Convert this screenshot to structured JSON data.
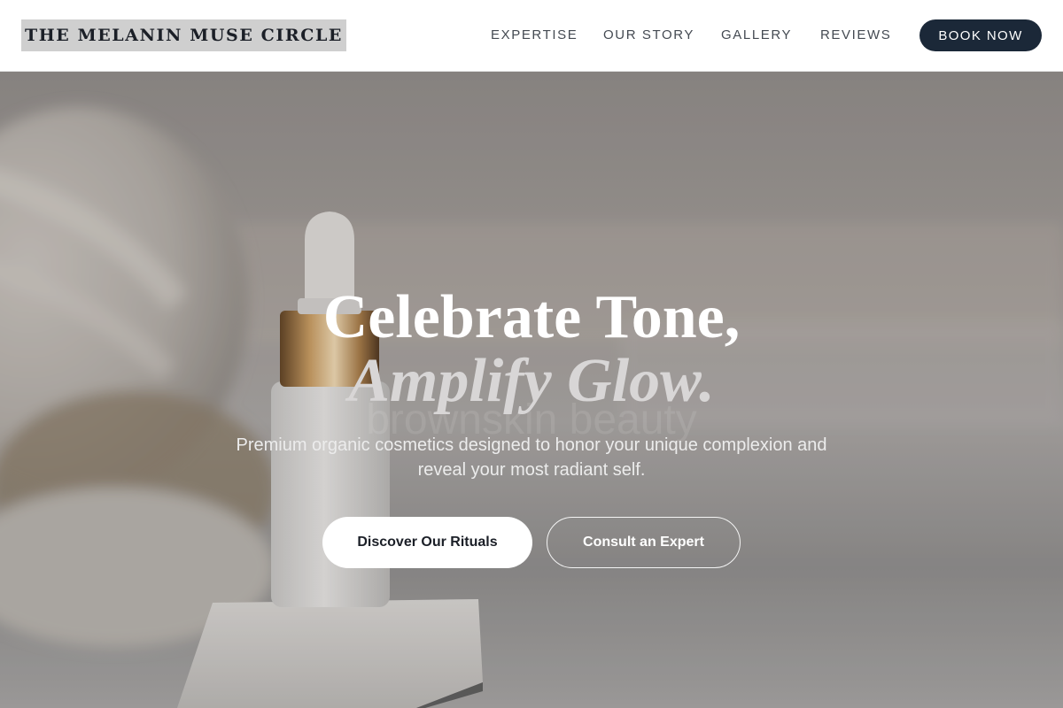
{
  "brand": {
    "name": "THE MELANIN MUSE CIRCLE"
  },
  "nav": {
    "links": [
      "EXPERTISE",
      "OUR STORY",
      "GALLERY",
      "REVIEWS"
    ],
    "cta": "BOOK NOW"
  },
  "hero": {
    "title_line1": "Celebrate Tone,",
    "title_line2": "Amplify Glow.",
    "watermark": "brownskin beauty",
    "subtitle": "Premium organic cosmetics designed to honor your unique complexion and reveal your most radiant self.",
    "primary_cta": "Discover Our Rituals",
    "secondary_cta": "Consult an Expert",
    "image_subject": "serum-dropper-bottle-on-marble-with-towel"
  },
  "colors": {
    "accent_dark": "#1b2838",
    "brand_bg": "#cfcfcf",
    "hero_text": "#ffffff"
  }
}
